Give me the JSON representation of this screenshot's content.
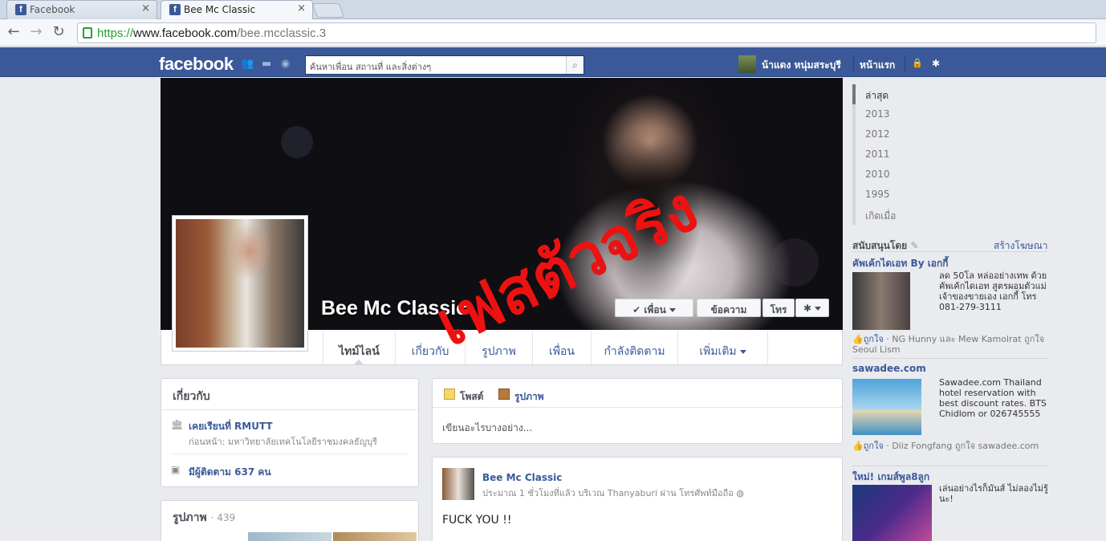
{
  "browser": {
    "tabs": [
      {
        "title": "Facebook",
        "favicon": "facebook-favicon-icon"
      },
      {
        "title": "Bee Mc Classic",
        "favicon": "facebook-favicon-icon"
      }
    ],
    "url": {
      "protocol": "https://",
      "host": "www.facebook.com",
      "path": "/bee.mcclassic.3"
    }
  },
  "header": {
    "logo": "facebook",
    "search_placeholder": "ค้นหาเพื่อน สถานที่ และสิ่งต่างๆ",
    "user_name": "น้าแดง หนุ่มสระบุรี",
    "home": "หน้าแรก"
  },
  "profile": {
    "name": "Bee Mc Classic",
    "buttons": {
      "friend": "✔ เพื่อน",
      "message": "ข้อความ",
      "phone": "โทร"
    },
    "tabs": [
      "ไทม์ไลน์",
      "เกี่ยวกับ",
      "รูปภาพ",
      "เพื่อน",
      "กำลังติดตาม",
      "เพิ่มเติม"
    ]
  },
  "timeline_years": [
    "ล่าสุด",
    "2013",
    "2012",
    "2011",
    "2010",
    "1995",
    "เกิดเมื่อ"
  ],
  "about": {
    "title": "เกี่ยวกับ",
    "school": "เคยเรียนที่ RMUTT",
    "school_previous": "ก่อนหน้า: มหาวิทยาลัยเทคโนโลยีราชมงคลธัญบุรี",
    "followers": "มีผู้ติดตาม 637 คน"
  },
  "photos": {
    "title": "รูปภาพ",
    "count": "· 439"
  },
  "composer": {
    "post_tab": "โพสต์",
    "photo_tab": "รูปภาพ",
    "placeholder": "เขียนอะไรบางอย่าง..."
  },
  "post": {
    "author": "Bee Mc Classic",
    "meta": "ประมาณ 1 ชั่วโมงที่แล้ว บริเวณ Thanyaburi ผ่าน โทรศัพท์มือถือ",
    "text": "FUCK YOU !!"
  },
  "ads": {
    "sponsored": "สนับสนุนโดย",
    "create_ad": "สร้างโฆษณา",
    "items": [
      {
        "title": "คัพเค้กไดเอท By เอกกี้",
        "body": "ลด 50โล หล่ออย่างเทพ ด้วยคัพเค้กไดเอท สูตรผอมตัวแม่ เจ้าของขายเอง เอกกี้ โทร 081-279-3111",
        "like": "ถูกใจ",
        "social": "· NG Hunny และ Mew Kamolrat ถูกใจ Seoul Lism"
      },
      {
        "title": "sawadee.com",
        "body": "Sawadee.com Thailand hotel reservation with best discount rates. BTS Chidlom or 026745555",
        "like": "ถูกใจ",
        "social": "· Diiz Fongfang ถูกใจ sawadee.com"
      },
      {
        "title": "ใหม่! เกมส์พูล8ลูก",
        "body": "เล่นอย่างไรก็มันส์ ไม่ลองไม่รู้นะ!"
      }
    ]
  },
  "watermark": "เฟสตัวจริง",
  "colors": {
    "brand": "#3b5998",
    "watermark": "#ee1111"
  }
}
